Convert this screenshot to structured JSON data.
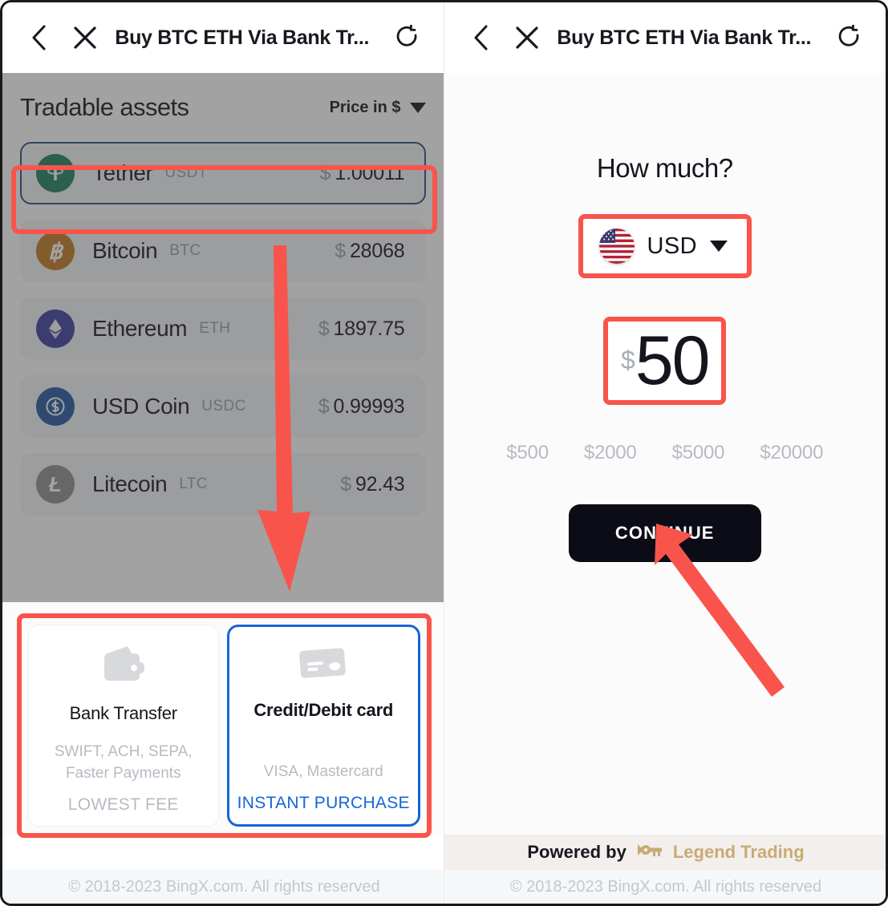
{
  "colors": {
    "highlight_red": "#F9544B",
    "selected_blue": "#1565D8",
    "asset_selected_border": "#2B4A8B",
    "continue_bg": "#0C0C16",
    "legend_gold": "#C9AB74"
  },
  "left_panel": {
    "topbar": {
      "back_icon": "chevron-left-icon",
      "close_icon": "close-icon",
      "title": "Buy BTC ETH Via Bank Tr...",
      "refresh_icon": "refresh-icon"
    },
    "assets": {
      "title": "Tradable assets",
      "price_toggle_label": "Price in $",
      "rows": [
        {
          "name": "Tether",
          "symbol": "USDT",
          "currency": "$",
          "price": "1.00011",
          "icon_letter": "₮",
          "icon_color": "#1B7F5E",
          "selected": true
        },
        {
          "name": "Bitcoin",
          "symbol": "BTC",
          "currency": "$",
          "price": "28068",
          "icon_letter": "฿",
          "icon_color": "#C2791E",
          "selected": false
        },
        {
          "name": "Ethereum",
          "symbol": "ETH",
          "currency": "$",
          "price": "1897.75",
          "icon_letter": "⧫",
          "icon_color": "#3C3CA0",
          "selected": false
        },
        {
          "name": "USD Coin",
          "symbol": "USDC",
          "currency": "$",
          "price": "0.99993",
          "icon_letter": "$",
          "icon_color": "#2256A0",
          "selected": false
        },
        {
          "name": "Litecoin",
          "symbol": "LTC",
          "currency": "$",
          "price": "92.43",
          "icon_letter": "Ł",
          "icon_color": "#8E8E8E",
          "selected": false
        }
      ]
    },
    "payment_methods": [
      {
        "icon": "wallet-icon",
        "title": "Bank Transfer",
        "subtitle": "SWIFT, ACH, SEPA, Faster Payments",
        "tag": "LOWEST FEE",
        "active": false
      },
      {
        "icon": "credit-card-icon",
        "title": "Credit/Debit card",
        "subtitle": "VISA, Mastercard",
        "tag": "INSTANT PURCHASE",
        "active": true
      }
    ],
    "copyright": "© 2018-2023 BingX.com. All rights reserved"
  },
  "right_panel": {
    "topbar": {
      "back_icon": "chevron-left-icon",
      "close_icon": "close-icon",
      "title": "Buy BTC ETH Via Bank Tr...",
      "refresh_icon": "refresh-icon"
    },
    "heading": "How much?",
    "currency": {
      "flag": "us-flag-icon",
      "code": "USD",
      "caret": "chevron-down-icon"
    },
    "amount": {
      "currency_symbol": "$",
      "value": "50"
    },
    "quick_amounts": [
      "$500",
      "$2000",
      "$5000",
      "$20000"
    ],
    "continue_label": "CONTINUE",
    "powered_by": {
      "prefix": "Powered by",
      "icon": "key-icon",
      "brand": "Legend Trading"
    },
    "copyright": "© 2018-2023 BingX.com. All rights reserved"
  },
  "annotations": {
    "down_arrow": "red-down-arrow",
    "up_left_arrow": "red-up-left-arrow",
    "highlight_boxes": [
      "tether-row",
      "payment-methods",
      "currency-selector",
      "amount-field"
    ]
  }
}
